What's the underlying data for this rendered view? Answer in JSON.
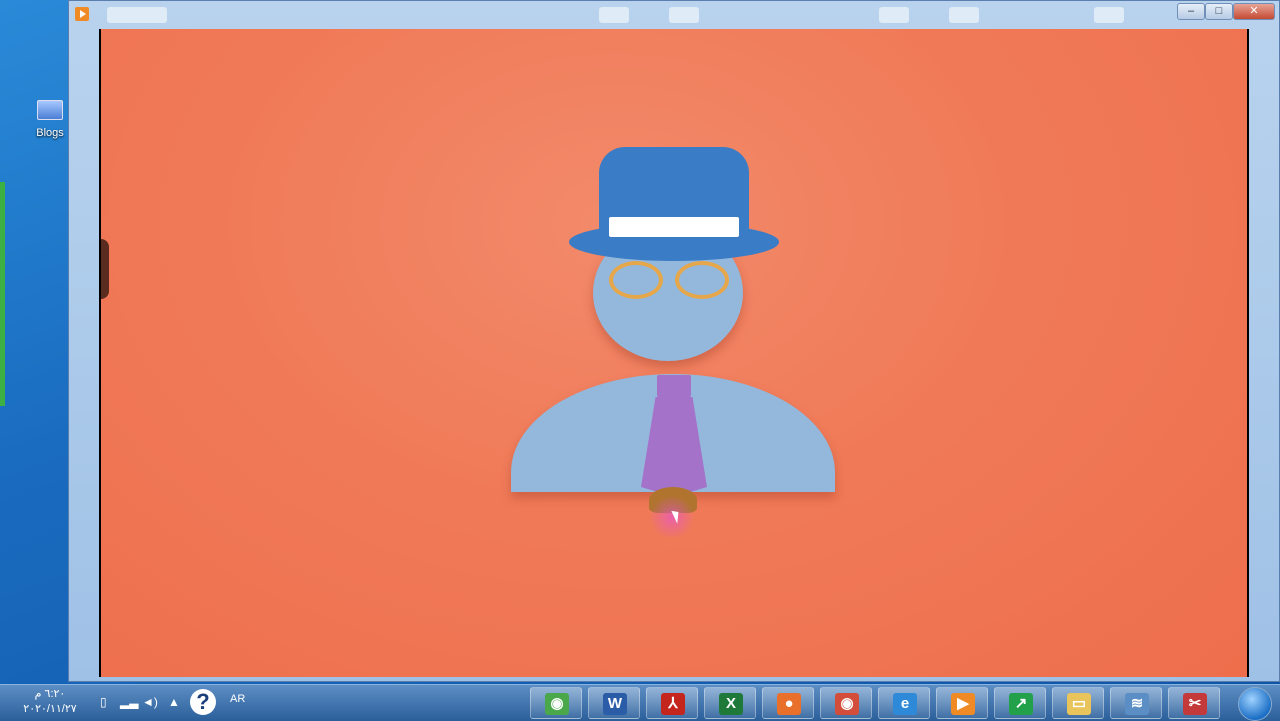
{
  "desktop": {
    "icon_label": "Blogs"
  },
  "window": {
    "controls": {
      "minimize": "–",
      "maximize": "□",
      "close": "✕"
    }
  },
  "taskbar": {
    "time": "٦:٢٠ م",
    "date": "٢٠٢٠/١١/٢٧",
    "language": "AR",
    "help_glyph": "?",
    "buttons": [
      {
        "name": "chrome",
        "glyph": "◉",
        "color": "#4aa84a"
      },
      {
        "name": "word",
        "glyph": "W",
        "color": "#2b5ca8"
      },
      {
        "name": "acrobat",
        "glyph": "⅄",
        "color": "#c4261d"
      },
      {
        "name": "excel",
        "glyph": "X",
        "color": "#1f7a3a"
      },
      {
        "name": "firefox",
        "glyph": "●",
        "color": "#e8702a"
      },
      {
        "name": "chrome-alt",
        "glyph": "◉",
        "color": "#d24e3a"
      },
      {
        "name": "internet-explorer",
        "glyph": "e",
        "color": "#2e8ad8"
      },
      {
        "name": "video-recorder",
        "glyph": "▶",
        "color": "#f08a24"
      },
      {
        "name": "stocks",
        "glyph": "↗",
        "color": "#22a04a"
      },
      {
        "name": "file-explorer",
        "glyph": "▭",
        "color": "#e8c45a"
      },
      {
        "name": "wifi",
        "glyph": "≋",
        "color": "#5a8ec4"
      },
      {
        "name": "snipping-tool",
        "glyph": "✂",
        "color": "#c43a3a"
      }
    ]
  },
  "colors": {
    "video_bg": "#f07a58",
    "hat": "#3a7cc6",
    "skin": "#93b8dc",
    "glasses": "#e6a64a",
    "tie": "#a572c9"
  }
}
